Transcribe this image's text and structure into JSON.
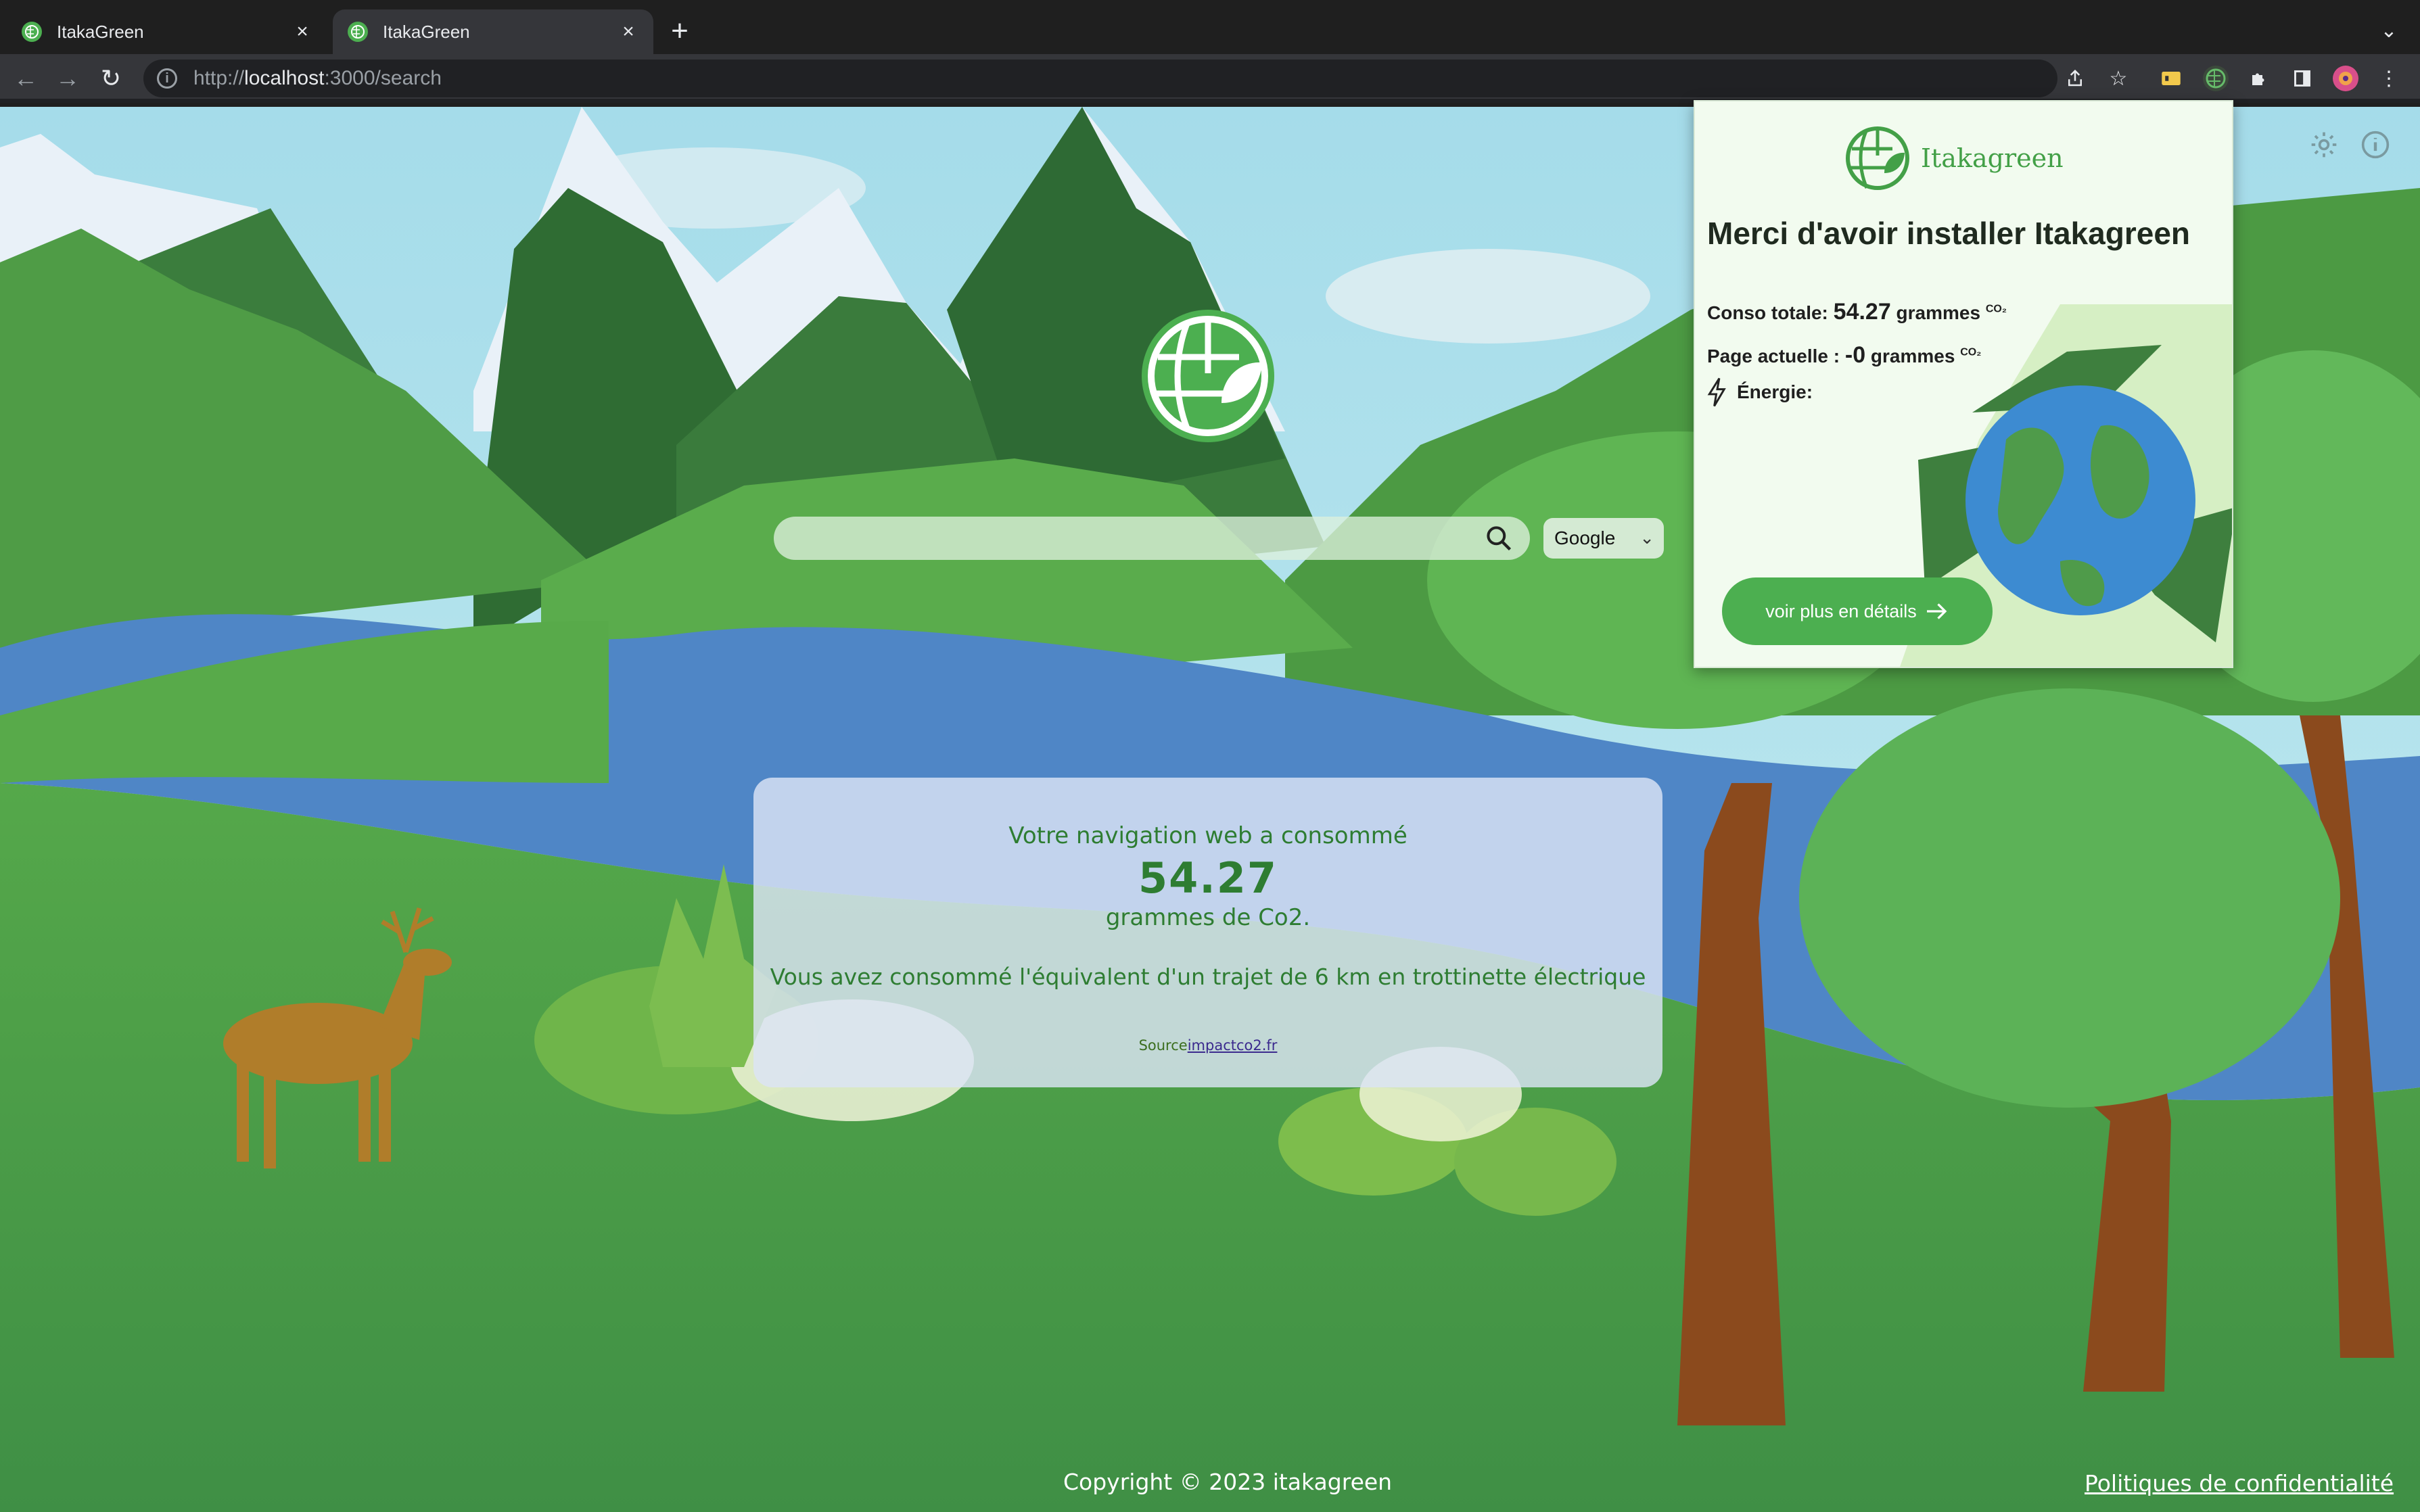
{
  "browser": {
    "tabs": [
      {
        "title": "ItakaGreen",
        "active": false
      },
      {
        "title": "ItakaGreen",
        "active": true
      }
    ],
    "url": {
      "scheme": "http://",
      "host": "localhost",
      "path": ":3000/search"
    }
  },
  "page": {
    "search": {
      "placeholder": "",
      "engine": "Google"
    },
    "card": {
      "line1": "Votre navigation web a consommé",
      "value": "54.27",
      "line2": "grammes de Co2.",
      "equivalent": "Vous avez consommé l'équivalent d'un trajet de 6 km en trottinette électrique",
      "source_label": "Source",
      "source_link": "impactco2.fr"
    },
    "footer": {
      "copyright": "Copyright © 2023 itakagreen",
      "privacy": "Politiques de confidentialité"
    }
  },
  "popup": {
    "brand": "Itakagreen",
    "heading": "Merci d'avoir installer Itakagreen",
    "total_label": "Conso totale:",
    "total_value": "54.27",
    "current_label": "Page actuelle :",
    "current_value": "-0",
    "unit": "grammes",
    "co2_sup": "CO₂",
    "energy_label": "Énergie:",
    "details_button": "voir plus en détails"
  },
  "colors": {
    "brand_green": "#4caf50",
    "text_green": "#2e7d32",
    "sky": "#a9dde8"
  }
}
